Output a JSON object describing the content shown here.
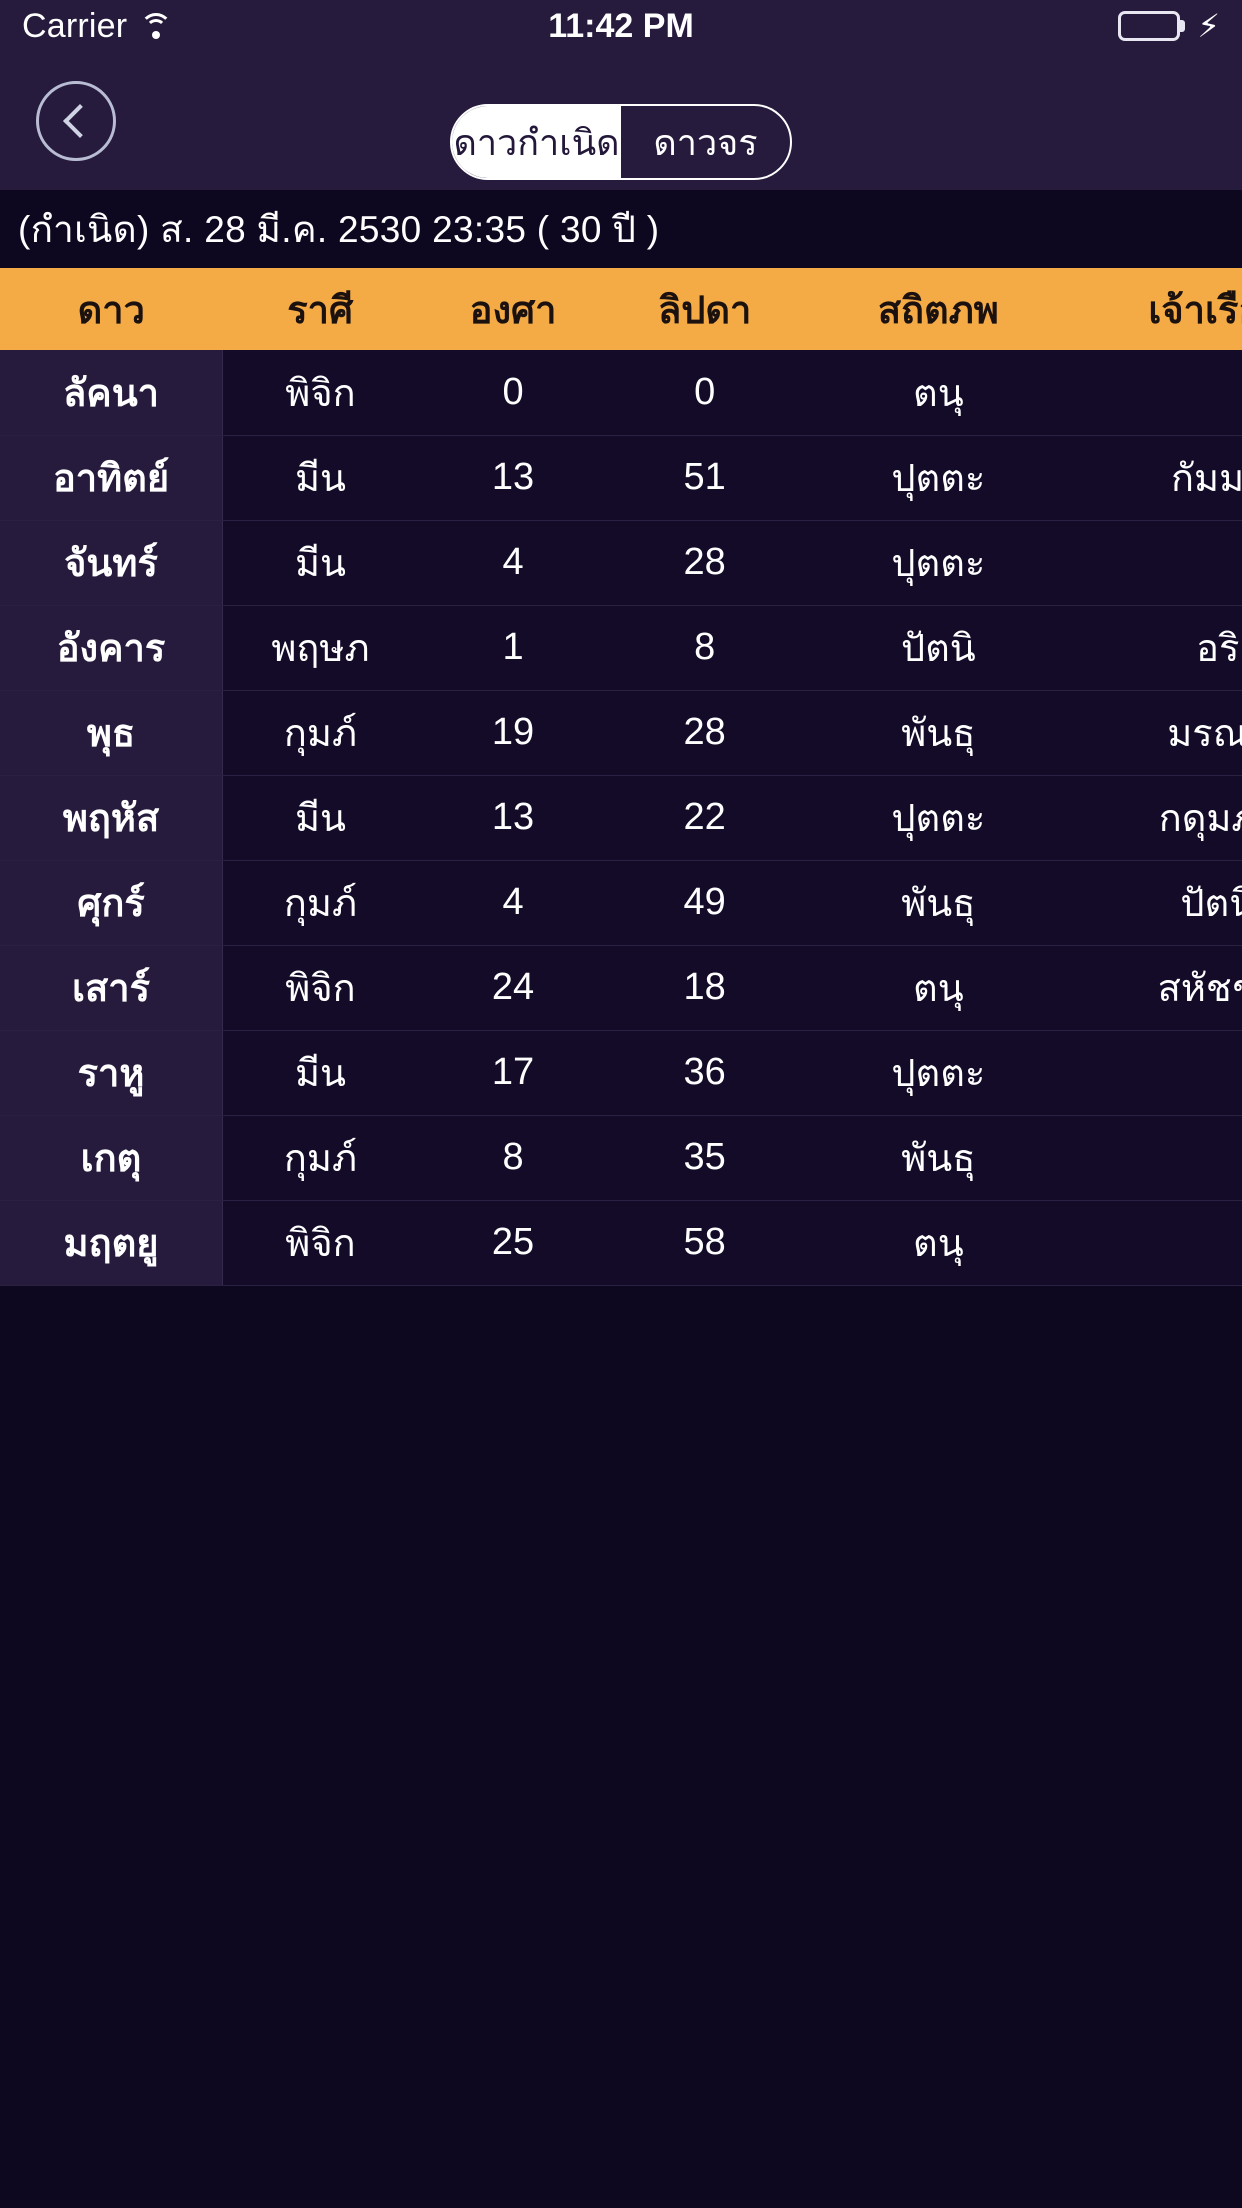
{
  "status_bar": {
    "carrier": "Carrier",
    "wifi_icon": "wifi-icon",
    "time": "11:42 PM",
    "battery_icon": "battery-icon",
    "charging_icon": "lightning-bolt-icon"
  },
  "nav": {
    "back_icon": "chevron-left-icon",
    "segments": [
      {
        "label": "ดาวกำเนิด",
        "selected": true
      },
      {
        "label": "ดาวจร",
        "selected": false
      }
    ]
  },
  "date_bar": {
    "text": "(กำเนิด) ส. 28 มี.ค. 2530 23:35 ( 30 ปี )"
  },
  "colors": {
    "header_orange": "#f4ab46",
    "page_background": "#0d0720",
    "bar_background": "#261b3d",
    "row_background": "#130b28",
    "name_column_background": "#261b3d",
    "battery_green": "#3bd64a"
  },
  "table": {
    "headers": [
      "ดาว",
      "ราศี",
      "องศา",
      "ลิปดา",
      "สถิตภพ",
      "เจ้าเรือน"
    ],
    "rows": [
      {
        "star": "ลัคนา",
        "sign": "พิจิก",
        "degree": "0",
        "minute": "0",
        "house": "ตนุ",
        "lord": ""
      },
      {
        "star": "อาทิตย์",
        "sign": "มีน",
        "degree": "13",
        "minute": "51",
        "house": "ปุตตะ",
        "lord": "กัมมะ"
      },
      {
        "star": "จันทร์",
        "sign": "มีน",
        "degree": "4",
        "minute": "28",
        "house": "ปุตตะ",
        "lord": ""
      },
      {
        "star": "อังคาร",
        "sign": "พฤษภ",
        "degree": "1",
        "minute": "8",
        "house": "ปัตนิ",
        "lord": "อริ"
      },
      {
        "star": "พุธ",
        "sign": "กุมภ์",
        "degree": "19",
        "minute": "28",
        "house": "พันธุ",
        "lord": "มรณะ"
      },
      {
        "star": "พฤหัส",
        "sign": "มีน",
        "degree": "13",
        "minute": "22",
        "house": "ปุตตะ",
        "lord": "กดุมภะ"
      },
      {
        "star": "ศุกร์",
        "sign": "กุมภ์",
        "degree": "4",
        "minute": "49",
        "house": "พันธุ",
        "lord": "ปัตนิ"
      },
      {
        "star": "เสาร์",
        "sign": "พิจิก",
        "degree": "24",
        "minute": "18",
        "house": "ตนุ",
        "lord": "สหัชชะ"
      },
      {
        "star": "ราหู",
        "sign": "มีน",
        "degree": "17",
        "minute": "36",
        "house": "ปุตตะ",
        "lord": ""
      },
      {
        "star": "เกตุ",
        "sign": "กุมภ์",
        "degree": "8",
        "minute": "35",
        "house": "พันธุ",
        "lord": ""
      },
      {
        "star": "มฤตยู",
        "sign": "พิจิก",
        "degree": "25",
        "minute": "58",
        "house": "ตนุ",
        "lord": ""
      }
    ]
  }
}
